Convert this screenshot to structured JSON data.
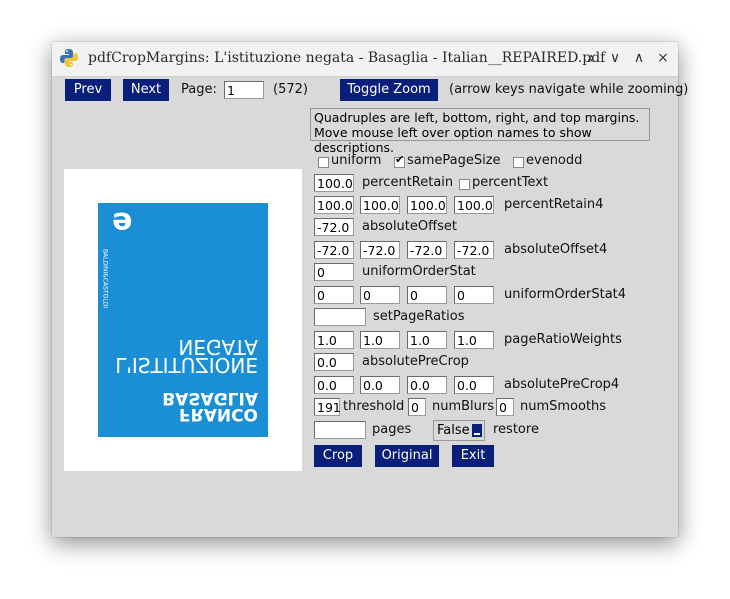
{
  "window": {
    "title": "pdfCropMargins: L'istituzione negata - Basaglia - Italian__REPAIRED.pdf",
    "controls": [
      "⩓",
      "∨",
      "∧",
      "×"
    ]
  },
  "nav": {
    "prev_label": "Prev",
    "next_label": "Next",
    "page_label": "Page:",
    "page_value": "1",
    "page_count": "(572)",
    "toggle_zoom_label": "Toggle Zoom",
    "zoom_hint": "(arrow keys navigate while zooming)"
  },
  "info": {
    "line1": "Quadruples are left, bottom, right, and top margins.",
    "line2": "Move mouse left over option names to show descriptions."
  },
  "options": {
    "uniform": {
      "label": "uniform",
      "checked": false
    },
    "samePageSize": {
      "label": "samePageSize",
      "checked": true
    },
    "evenodd": {
      "label": "evenodd",
      "checked": false
    },
    "percentRetain": {
      "value": "100.0",
      "label": "percentRetain"
    },
    "percentText": {
      "label": "percentText",
      "checked": false
    },
    "percentRetain4": {
      "values": [
        "100.0",
        "100.0",
        "100.0",
        "100.0"
      ],
      "label": "percentRetain4"
    },
    "absoluteOffset": {
      "value": "-72.0",
      "label": "absoluteOffset"
    },
    "absoluteOffset4": {
      "values": [
        "-72.0",
        "-72.0",
        "-72.0",
        "-72.0"
      ],
      "label": "absoluteOffset4"
    },
    "uniformOrderStat": {
      "value": "0",
      "label": "uniformOrderStat"
    },
    "uniformOrderStat4": {
      "values": [
        "0",
        "0",
        "0",
        "0"
      ],
      "label": "uniformOrderStat4"
    },
    "setPageRatios": {
      "value": "",
      "label": "setPageRatios"
    },
    "pageRatioWeights": {
      "values": [
        "1.0",
        "1.0",
        "1.0",
        "1.0"
      ],
      "label": "pageRatioWeights"
    },
    "absolutePreCrop": {
      "value": "0.0",
      "label": "absolutePreCrop"
    },
    "absolutePreCrop4": {
      "values": [
        "0.0",
        "0.0",
        "0.0",
        "0.0"
      ],
      "label": "absolutePreCrop4"
    },
    "threshold": {
      "value": "191",
      "label": "threshold"
    },
    "numBlurs": {
      "value": "0",
      "label": "numBlurs"
    },
    "numSmooths": {
      "value": "0",
      "label": "numSmooths"
    },
    "pages": {
      "value": "",
      "label": "pages"
    },
    "restore": {
      "value": "False",
      "label": "restore"
    }
  },
  "actions": {
    "crop_label": "Crop",
    "original_label": "Original",
    "exit_label": "Exit"
  },
  "cover": {
    "publisher": "BALDINI&CASTOLDI",
    "title_line1": "NEGATA",
    "title_line2": "L'ISTITUZIONE",
    "author_line1": "BASAGLIA",
    "author_line2": "FRANCO",
    "logo_glyph": "e",
    "color": "#1a8fd6"
  },
  "colors": {
    "button_bg": "#0a1f7a",
    "window_bg": "#d9d9d9"
  }
}
